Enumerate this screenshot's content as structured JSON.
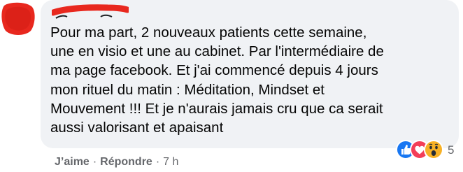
{
  "comment": {
    "text": "Pour ma part, 2 nouveaux patients cette semaine,\nune en visio et une au cabinet. Par l'intermédiaire de\nma page facebook. Et j'ai commencé depuis 4 jours\nmon rituel du matin : Méditation, Mindset et\nMouvement !!! Et je n'aurais jamais cru que ca serait\naussi valorisant et apaisant"
  },
  "actions": {
    "like_label": "J’aime",
    "separator": "·",
    "reply_label": "Répondre",
    "time": "7 h"
  },
  "reactions": {
    "icons": [
      "like-icon",
      "love-icon",
      "wow-icon"
    ],
    "count": "5"
  },
  "colors": {
    "bubble_bg": "#f0f2f5",
    "text": "#050505",
    "meta": "#65676b",
    "like_blue": "#1877f2",
    "love_red": "#f33e58",
    "wow_yellow": "#f7b125",
    "redaction": "#e8281e"
  }
}
